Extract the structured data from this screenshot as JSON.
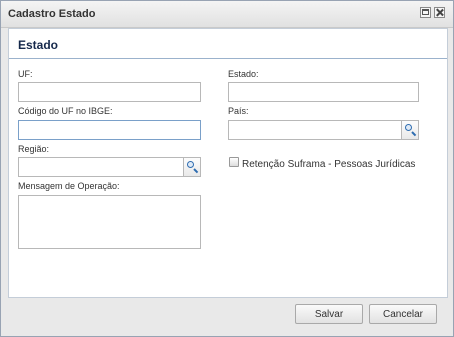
{
  "window": {
    "title": "Cadastro Estado",
    "maximize_icon": "maximize-icon",
    "close_icon": "close-icon"
  },
  "panel": {
    "title": "Estado"
  },
  "form": {
    "uf": {
      "label": "UF:",
      "value": ""
    },
    "estado": {
      "label": "Estado:",
      "value": ""
    },
    "codigo_ibge": {
      "label": "Código do UF no IBGE:",
      "value": ""
    },
    "pais": {
      "label": "País:",
      "value": "",
      "lookup_icon": "search-icon"
    },
    "regiao": {
      "label": "Região:",
      "value": "",
      "lookup_icon": "search-icon"
    },
    "retencao_suframa": {
      "label": "Retenção Suframa - Pessoas Jurídicas",
      "checked": false
    },
    "mensagem_operacao": {
      "label": "Mensagem de Operação:",
      "value": ""
    }
  },
  "footer": {
    "save_label": "Salvar",
    "cancel_label": "Cancelar"
  },
  "colors": {
    "panel_title": "#15284b",
    "header_rule": "#9bb2cc",
    "focus_border": "#7aa0c9",
    "search_icon": "#2f6db0"
  }
}
